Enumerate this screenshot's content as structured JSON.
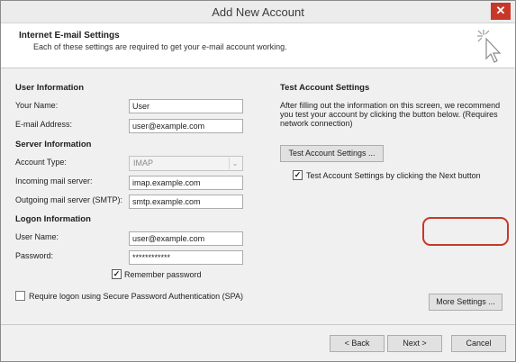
{
  "window": {
    "title": "Add New Account",
    "close_glyph": "✕"
  },
  "header": {
    "title": "Internet E-mail Settings",
    "subtitle": "Each of these settings are required to get your e-mail account working."
  },
  "user_info": {
    "section_title": "User Information",
    "name_label": "Your Name:",
    "name_value": "User",
    "email_label": "E-mail Address:",
    "email_value": "user@example.com"
  },
  "server_info": {
    "section_title": "Server Information",
    "account_type_label": "Account Type:",
    "account_type_value": "IMAP",
    "incoming_label": "Incoming mail server:",
    "incoming_value": "imap.example.com",
    "outgoing_label": "Outgoing mail server (SMTP):",
    "outgoing_value": "smtp.example.com"
  },
  "logon_info": {
    "section_title": "Logon Information",
    "username_label": "User Name:",
    "username_value": "user@example.com",
    "password_label": "Password:",
    "password_value": "************",
    "remember_label": "Remember password",
    "remember_checked": true,
    "spa_label": "Require logon using Secure Password Authentication (SPA)",
    "spa_checked": false
  },
  "test_settings": {
    "section_title": "Test Account Settings",
    "description": "After filling out the information on this screen, we recommend you test your account by clicking the button below. (Requires network connection)",
    "test_button": "Test Account Settings ...",
    "auto_test_label": "Test Account Settings by clicking the Next button",
    "auto_test_checked": true
  },
  "more_settings_button": "More Settings ...",
  "footer": {
    "back_button": "< Back",
    "next_button": "Next >",
    "cancel_button": "Cancel"
  },
  "colors": {
    "accent_red": "#c7382a"
  }
}
